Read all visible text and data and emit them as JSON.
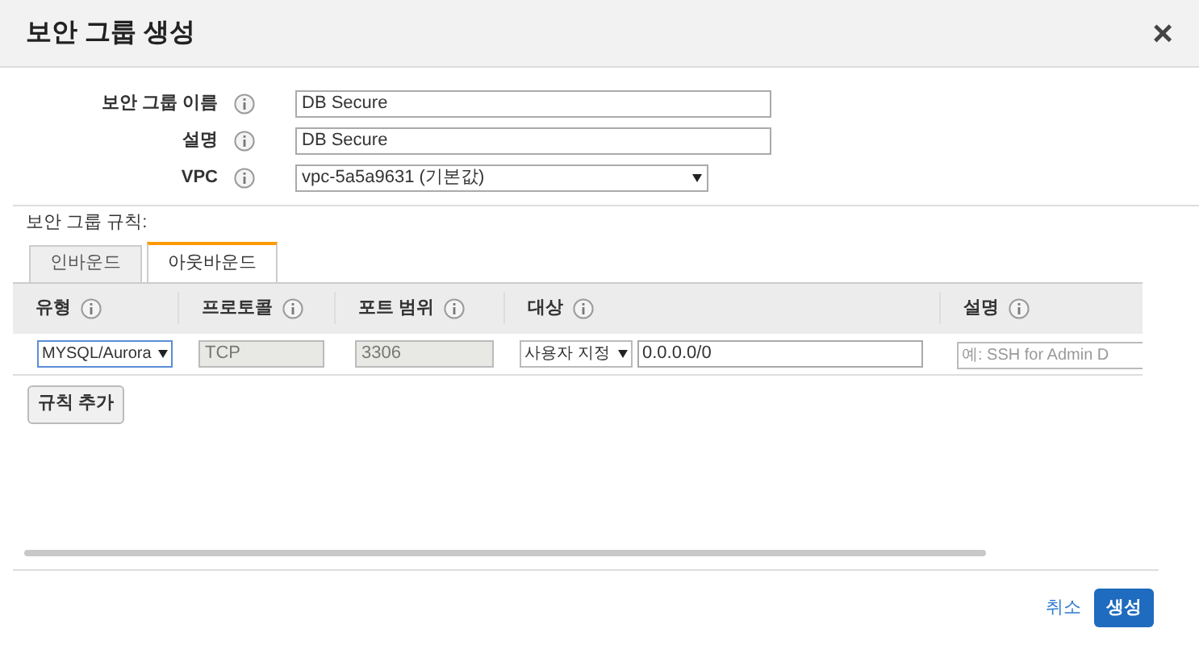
{
  "dialog": {
    "title": "보안 그룹 생성",
    "close": "×"
  },
  "fields": [
    {
      "kind": "input",
      "label": "보안 그룹 이름",
      "value": "DB Secure"
    },
    {
      "kind": "input",
      "label": "설명",
      "value": "DB Secure"
    },
    {
      "kind": "select",
      "label": "VPC",
      "value": "vpc-5a5a9631 (기본값)"
    }
  ],
  "rules_label": "보안 그룹 규칙:",
  "tabs": [
    {
      "label": "인바운드",
      "selected": false
    },
    {
      "label": "아웃바운드",
      "selected": true
    }
  ],
  "table": {
    "columns": [
      "유형",
      "프로토콜",
      "포트 범위",
      "대상",
      "설명"
    ],
    "rows": [
      {
        "type": "MYSQL/Aurora",
        "protocol": "TCP",
        "port": "3306",
        "source_kind": "사용자 지정",
        "cidr": "0.0.0.0/0",
        "description_placeholder": "예: SSH for Admin D"
      }
    ]
  },
  "add_rule": "규칙 추가",
  "footer": {
    "cancel": "취소",
    "create": "생성"
  }
}
